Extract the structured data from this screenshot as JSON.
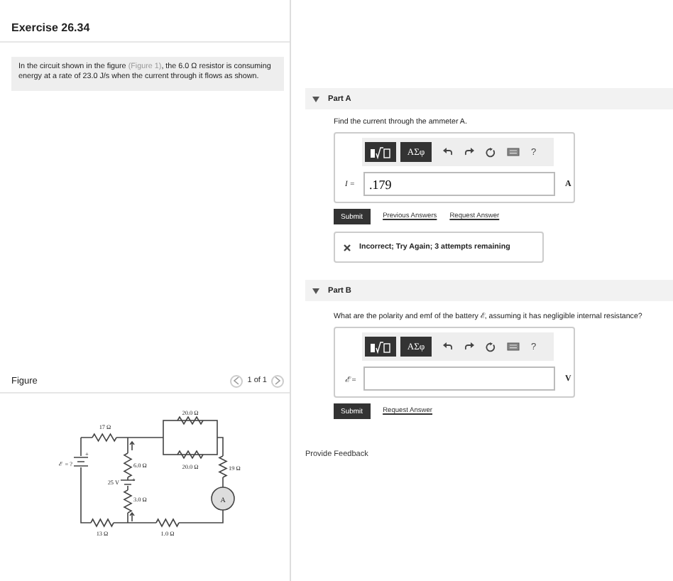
{
  "title": "Exercise 26.34",
  "problem": {
    "before": "In the circuit shown in the figure ",
    "link": "(Figure 1)",
    "after": ", the 6.0 Ω resistor is consuming energy at a rate of 23.0 J/s when the current through it flows as shown."
  },
  "figure": {
    "title": "Figure",
    "pager": "1 of 1",
    "ammeter": "A",
    "labels": [
      "20.0 Ω",
      "17 Ω",
      "+",
      "ℰ = ?",
      "6.0 Ω",
      "20.0 Ω",
      "19 Ω",
      "+",
      "25 V",
      "3.0 Ω",
      "13 Ω",
      "1.0 Ω"
    ]
  },
  "parts": [
    {
      "title": "Part A",
      "expanded": true,
      "question": "Find the current through the ammeter A.",
      "symbols": "ΑΣφ",
      "help": "?",
      "variable": "I =",
      "value": ".179",
      "unit": "A",
      "submit": "Submit",
      "links": [
        "Previous Answers",
        "Request Answer"
      ],
      "feedback": "Incorrect; Try Again; 3 attempts remaining"
    },
    {
      "title": "Part B",
      "expanded": true,
      "question": "What are the polarity and emf of the battery ℰ, assuming it has negligible internal resistance?",
      "symbols": "ΑΣφ",
      "help": "?",
      "variable": "ℰ =",
      "unit": "V",
      "submit": "Submit",
      "links": [
        "Request Answer"
      ]
    }
  ],
  "footer": "Provide Feedback"
}
